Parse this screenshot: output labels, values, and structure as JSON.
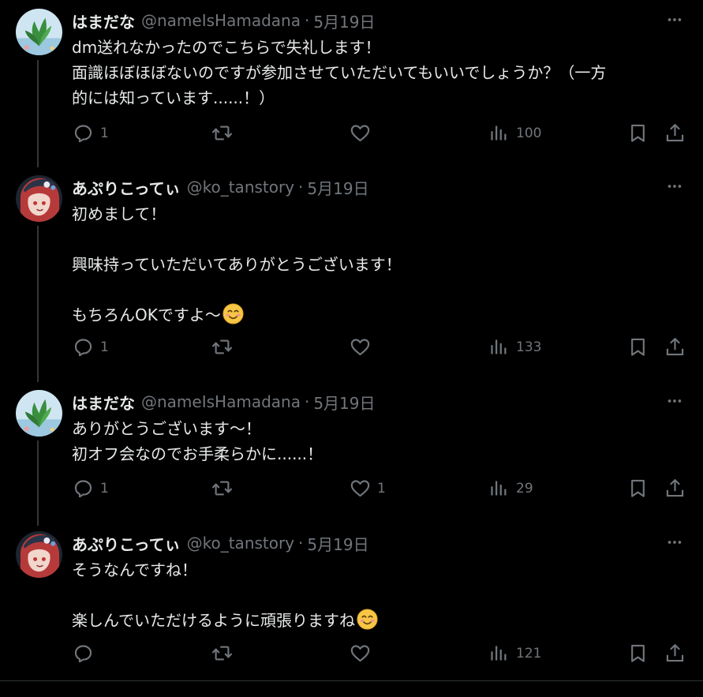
{
  "colors": {
    "background": "#000000",
    "text": "#e7e9ea",
    "muted": "#71767b",
    "thread": "#333639"
  },
  "icons": [
    "reply-icon",
    "retweet-icon",
    "like-icon",
    "views-icon",
    "bookmark-icon",
    "share-icon",
    "more-icon"
  ],
  "tweets": [
    {
      "name": "はまだな",
      "handle": "@nameIsHamadana",
      "dot": "·",
      "date": "5月19日",
      "lines": [
        "dm送れなかったのでこちらで失礼します！",
        "面識ほぼほぼないのですが参加させていただいてもいいでしょうか？（一方",
        "的には知っています......！）"
      ],
      "replies": "1",
      "retweets": "",
      "likes": "",
      "views": "100"
    },
    {
      "name": "あぷりこってぃ",
      "handle": "@ko_tanstory",
      "dot": "·",
      "date": "5月19日",
      "lines": [
        "初めまして！",
        "",
        "興味持っていただいてありがとうございます！",
        "",
        "もちろんOKですよ～"
      ],
      "replies": "1",
      "retweets": "",
      "likes": "",
      "views": "133"
    },
    {
      "name": "はまだな",
      "handle": "@nameIsHamadana",
      "dot": "·",
      "date": "5月19日",
      "lines": [
        "ありがとうございます～！",
        "初オフ会なのでお手柔らかに......！"
      ],
      "replies": "1",
      "retweets": "",
      "likes": "1",
      "views": "29"
    },
    {
      "name": "あぷりこってぃ",
      "handle": "@ko_tanstory",
      "dot": "·",
      "date": "5月19日",
      "lines": [
        "そうなんですね！",
        "",
        "楽しんでいただけるように頑張りますね"
      ],
      "replies": "",
      "retweets": "",
      "likes": "",
      "views": "121"
    }
  ]
}
